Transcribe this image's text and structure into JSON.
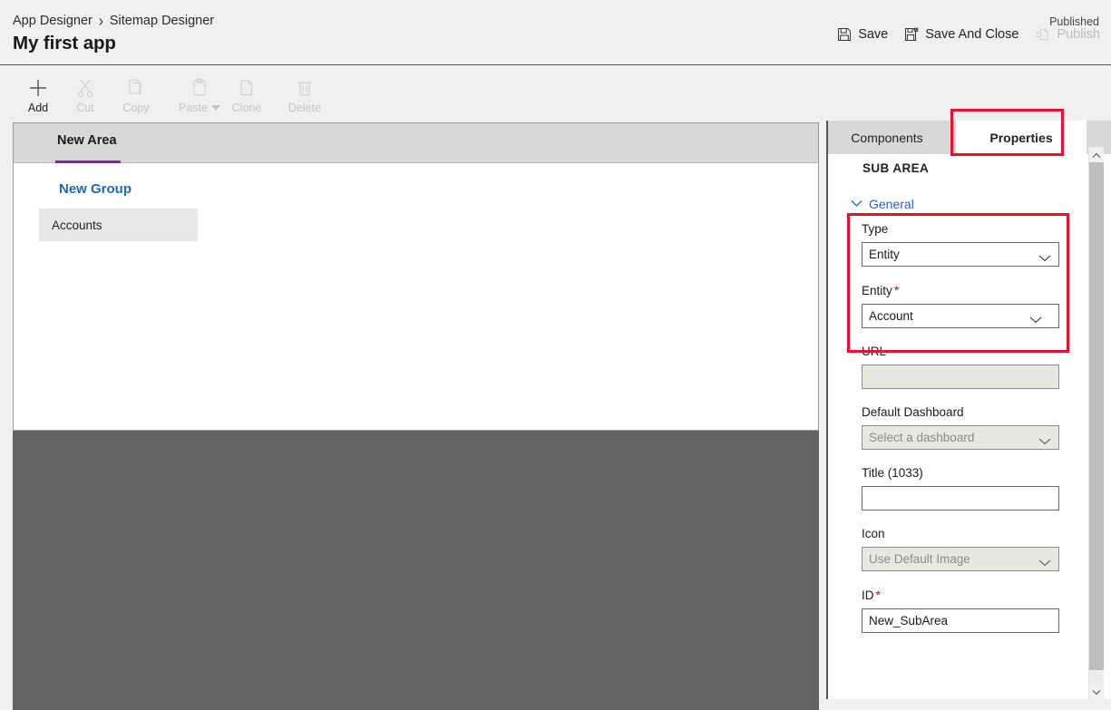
{
  "header": {
    "breadcrumb": [
      {
        "label": "App Designer"
      },
      {
        "label": "Sitemap Designer"
      }
    ],
    "separator": "›",
    "app_title": "My first app",
    "published_status": "Published",
    "actions": [
      {
        "label": "Save",
        "icon": "save-icon",
        "enabled": true
      },
      {
        "label": "Save And Close",
        "icon": "save-and-close-icon",
        "enabled": true
      },
      {
        "label": "Publish",
        "icon": "publish-icon",
        "enabled": false
      }
    ]
  },
  "toolbar": {
    "items": [
      {
        "label": "Add",
        "icon": "plus-icon",
        "enabled": true
      },
      {
        "label": "Cut",
        "icon": "scissors-icon",
        "enabled": false
      },
      {
        "label": "Copy",
        "icon": "copy-icon",
        "enabled": false
      },
      {
        "label": "Paste",
        "icon": "clipboard-icon",
        "enabled": false,
        "has_dropdown": true
      },
      {
        "label": "Clone",
        "icon": "clone-icon",
        "enabled": false
      },
      {
        "label": "Delete",
        "icon": "trash-icon",
        "enabled": false
      }
    ]
  },
  "canvas": {
    "area_tab": "New Area",
    "group_title": "New Group",
    "subarea_item": "Accounts"
  },
  "panel": {
    "tabs": [
      {
        "label": "Components",
        "active": false
      },
      {
        "label": "Properties",
        "active": true
      }
    ],
    "section_title": "SUB AREA",
    "general_label": "General",
    "fields": {
      "type": {
        "label": "Type",
        "value": "Entity",
        "required": false,
        "control": "select",
        "disabled": false
      },
      "entity": {
        "label": "Entity",
        "value": "Account",
        "required": true,
        "control": "select",
        "disabled": false
      },
      "url": {
        "label": "URL",
        "value": "",
        "placeholder": "",
        "required": false,
        "control": "text",
        "disabled": true
      },
      "default_dashboard": {
        "label": "Default Dashboard",
        "value": "",
        "placeholder": "Select a dashboard",
        "required": false,
        "control": "select",
        "disabled": true
      },
      "title": {
        "label": "Title (1033)",
        "value": "",
        "placeholder": "",
        "required": false,
        "control": "text",
        "disabled": false
      },
      "icon": {
        "label": "Icon",
        "value": "Use Default Image",
        "required": false,
        "control": "select",
        "disabled": true
      },
      "id": {
        "label": "ID",
        "value": "New_SubArea",
        "required": true,
        "control": "text",
        "disabled": false
      }
    },
    "required_marker": "*"
  },
  "annotations": {
    "highlight_color": "#e8112d",
    "boxes": [
      {
        "name": "properties-tab-highlight"
      },
      {
        "name": "type-entity-highlight"
      }
    ]
  },
  "colors": {
    "accent_purple": "#7b2d8b",
    "link_blue": "#2266bb",
    "dark_pane": "#646464",
    "tabstrip_grey": "#d8d8d8"
  }
}
